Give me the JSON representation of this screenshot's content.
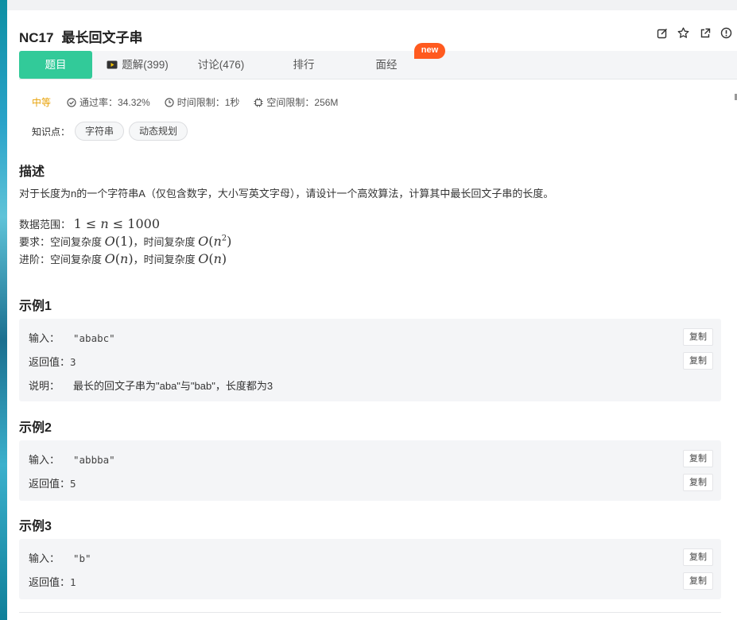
{
  "problem": {
    "id": "NC17",
    "title": "最长回文子串"
  },
  "tabs": [
    {
      "label": "题目"
    },
    {
      "label": "题解(399)"
    },
    {
      "label": "讨论(476)"
    },
    {
      "label": "排行"
    },
    {
      "label": "面经"
    }
  ],
  "badge": "new",
  "meta": {
    "difficulty": "中等",
    "pass_rate": "通过率：34.32%",
    "time_limit": "时间限制：1秒",
    "space_limit": "空间限制：256M"
  },
  "knowledge": {
    "label": "知识点：",
    "tags": [
      "字符串",
      "动态规划"
    ]
  },
  "description": {
    "heading": "描述",
    "text": "对于长度为n的一个字符串A（仅包含数字，大小写英文字母），请设计一个高效算法，计算其中最长回文子串的长度。",
    "range_label": "数据范围：",
    "req_label": "要求：空间复杂度",
    "req_time_label": "，时间复杂度",
    "adv_label": "进阶：空间复杂度",
    "adv_time_label": "，时间复杂度"
  },
  "examples": [
    {
      "heading": "示例1",
      "input_label": "输入：",
      "input": "\"ababc\"",
      "output_label": "返回值：",
      "output": "3",
      "note_label": "说明：",
      "note": "最长的回文子串为\"aba\"与\"bab\"，长度都为3"
    },
    {
      "heading": "示例2",
      "input_label": "输入：",
      "input": "\"abbba\"",
      "output_label": "返回值：",
      "output": "5"
    },
    {
      "heading": "示例3",
      "input_label": "输入：",
      "input": "\"b\"",
      "output_label": "返回值：",
      "output": "1"
    }
  ],
  "copy_label": "复制",
  "colors": {
    "accent": "#32ca99",
    "badge": "#ff5a1f",
    "difficulty": "#e8a106"
  },
  "icons": [
    "edit-icon",
    "star-icon",
    "share-icon",
    "report-icon",
    "video-icon",
    "check-circle-icon",
    "clock-icon",
    "memory-icon"
  ]
}
